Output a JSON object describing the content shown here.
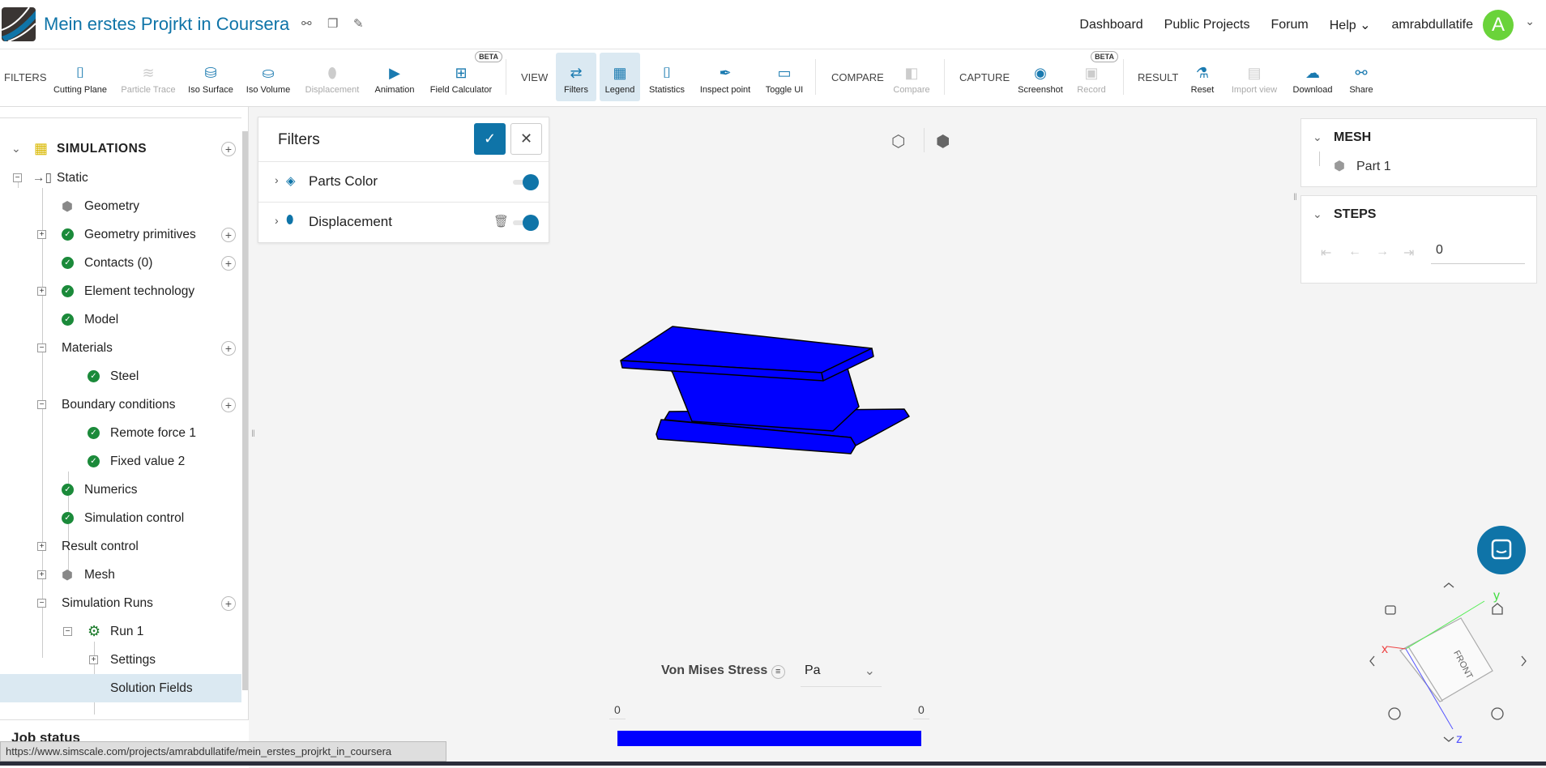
{
  "header": {
    "title": "Mein erstes Projrkt in Coursera",
    "nav": [
      "Dashboard",
      "Public Projects",
      "Forum",
      "Help"
    ],
    "user": "amrabdullatife",
    "avatar_letter": "A"
  },
  "toolbar": {
    "groups": {
      "filters": "FILTERS",
      "view": "VIEW",
      "compare": "COMPARE",
      "capture": "CAPTURE",
      "result": "RESULT"
    },
    "items": [
      {
        "label": "Cutting Plane",
        "icon": "cutting-plane-icon"
      },
      {
        "label": "Particle Trace",
        "icon": "particle-trace-icon",
        "disabled": true
      },
      {
        "label": "Iso Surface",
        "icon": "iso-surface-icon"
      },
      {
        "label": "Iso Volume",
        "icon": "iso-volume-icon"
      },
      {
        "label": "Displacement",
        "icon": "displacement-icon",
        "disabled": true
      },
      {
        "label": "Animation",
        "icon": "play-icon"
      },
      {
        "label": "Field Calculator",
        "icon": "calculator-icon",
        "badge": "BETA"
      },
      {
        "label": "Filters",
        "icon": "filters-icon",
        "active": true
      },
      {
        "label": "Legend",
        "icon": "legend-icon",
        "active": true
      },
      {
        "label": "Statistics",
        "icon": "statistics-icon"
      },
      {
        "label": "Inspect point",
        "icon": "pipette-icon"
      },
      {
        "label": "Toggle UI",
        "icon": "window-icon"
      },
      {
        "label": "Compare",
        "icon": "compare-icon",
        "disabled": true
      },
      {
        "label": "Screenshot",
        "icon": "camera-icon"
      },
      {
        "label": "Record",
        "icon": "record-icon",
        "disabled": true,
        "badge": "BETA"
      },
      {
        "label": "Reset",
        "icon": "flask-icon"
      },
      {
        "label": "Import view",
        "icon": "import-icon",
        "disabled": true
      },
      {
        "label": "Download",
        "icon": "cloud-download-icon"
      },
      {
        "label": "Share",
        "icon": "share-icon"
      }
    ]
  },
  "sidebar": {
    "section": "SIMULATIONS",
    "tree": [
      {
        "label": "Static"
      },
      {
        "label": "Geometry"
      },
      {
        "label": "Geometry primitives"
      },
      {
        "label": "Contacts (0)"
      },
      {
        "label": "Element technology"
      },
      {
        "label": "Model"
      },
      {
        "label": "Materials"
      },
      {
        "label": "Steel"
      },
      {
        "label": "Boundary conditions"
      },
      {
        "label": "Remote force 1"
      },
      {
        "label": "Fixed value 2"
      },
      {
        "label": "Numerics"
      },
      {
        "label": "Simulation control"
      },
      {
        "label": "Result control"
      },
      {
        "label": "Mesh"
      },
      {
        "label": "Simulation Runs"
      },
      {
        "label": "Run 1"
      },
      {
        "label": "Settings"
      },
      {
        "label": "Solution Fields",
        "selected": true
      }
    ],
    "job_status": "Job status"
  },
  "filters_panel": {
    "title": "Filters",
    "items": [
      {
        "label": "Parts Color",
        "enabled": true
      },
      {
        "label": "Displacement",
        "enabled": true
      }
    ]
  },
  "mesh_panel": {
    "title": "MESH",
    "part": "Part 1"
  },
  "steps_panel": {
    "title": "STEPS",
    "value": "0"
  },
  "legend": {
    "title": "Von Mises Stress",
    "unit": "Pa",
    "min": "0",
    "max": "0",
    "color": "#0000ff"
  },
  "viewcube": {
    "face": "FRONT",
    "axes": [
      "x",
      "y",
      "z"
    ]
  },
  "status_url": "https://www.simscale.com/projects/amrabdullatife/mein_erstes_projrkt_in_coursera",
  "colors": {
    "accent": "#0f74a8",
    "model": "#0000ff"
  }
}
